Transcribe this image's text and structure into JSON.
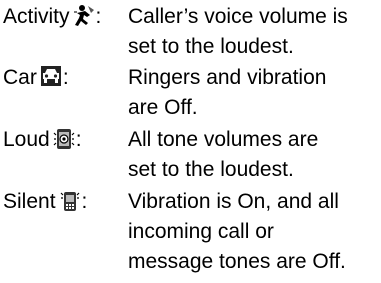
{
  "modes": [
    {
      "name": "Activity",
      "icon": "activity-mode-icon",
      "lines": [
        "Caller’s voice volume is",
        "set to the loudest."
      ]
    },
    {
      "name": "Car",
      "icon": "car-mode-icon",
      "lines": [
        "Ringers and vibration",
        "are Off."
      ]
    },
    {
      "name": "Loud",
      "icon": "loud-mode-icon",
      "lines": [
        "All tone volumes are",
        "set to the loudest."
      ]
    },
    {
      "name": "Silent",
      "icon": "silent-mode-icon",
      "lines": [
        "Vibration is On, and all",
        "incoming call or",
        "message tones are Off."
      ]
    }
  ],
  "colon": ":"
}
